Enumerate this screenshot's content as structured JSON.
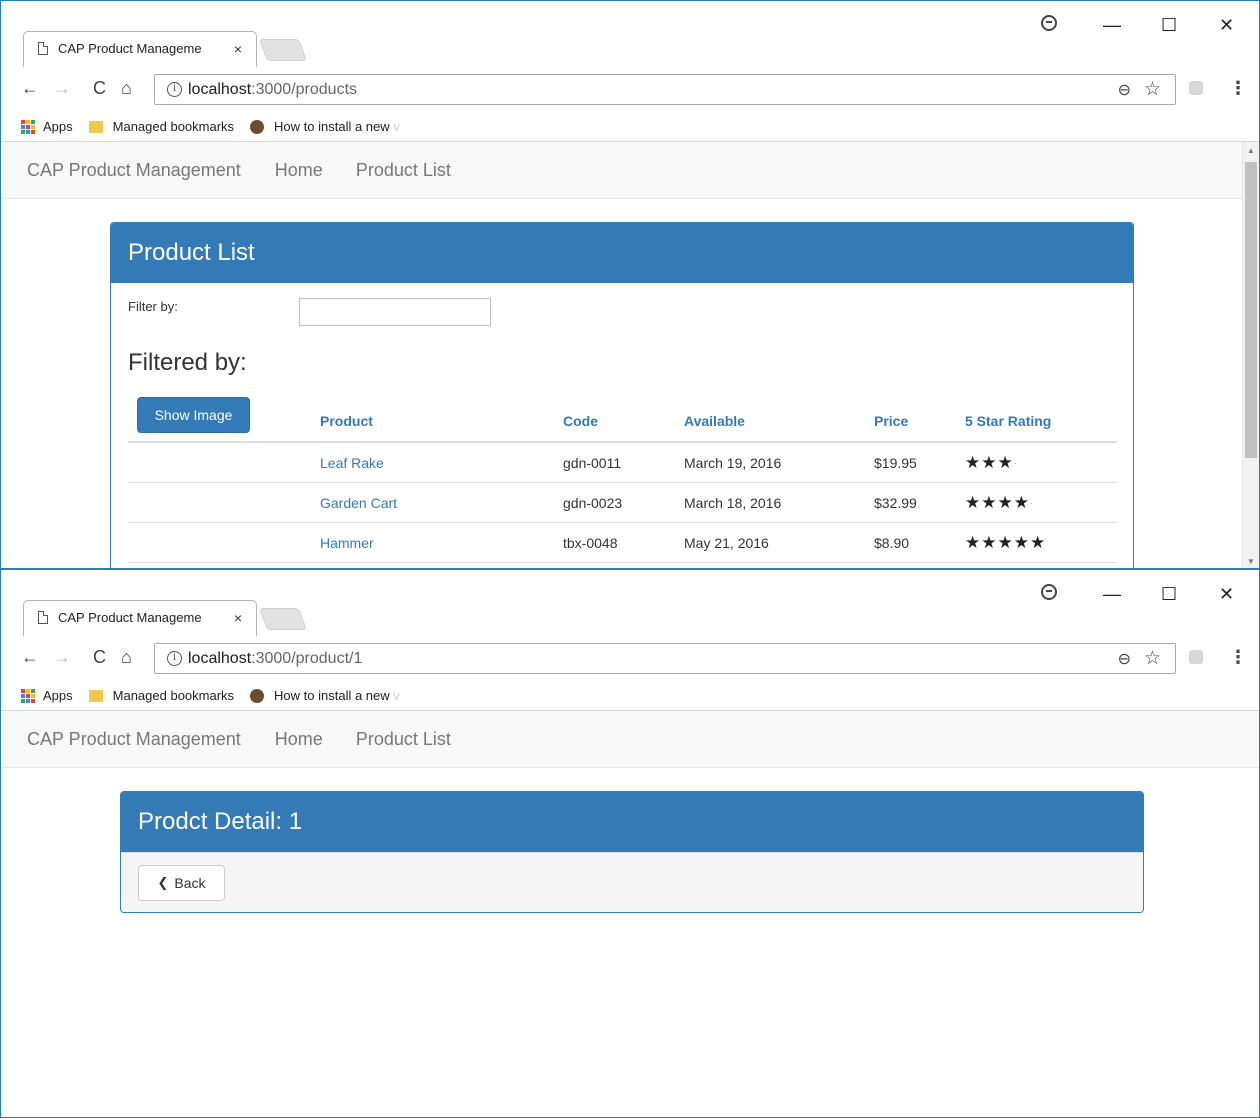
{
  "window_a": {
    "tab_title": "CAP Product Manageme",
    "tab_close": "×",
    "url_host": "localhost",
    "url_path": ":3000/products",
    "bookmarks": {
      "apps": "Apps",
      "managed": "Managed bookmarks",
      "howto": "How to install a new",
      "howto_fade": "v"
    },
    "nav": {
      "brand": "CAP Product Management",
      "home": "Home",
      "list": "Product List"
    },
    "panel": {
      "title": "Product List",
      "filter_label": "Filter by:",
      "filter_value": "",
      "filtered_by": "Filtered by:",
      "show_image": "Show Image",
      "columns": {
        "product": "Product",
        "code": "Code",
        "available": "Available",
        "price": "Price",
        "rating": "5 Star Rating"
      },
      "rows": [
        {
          "product": "Leaf Rake",
          "code": "gdn-0011",
          "available": "March 19, 2016",
          "price": "$19.95",
          "stars": "★★★",
          "partial": "·",
          "rating": 3.2
        },
        {
          "product": "Garden Cart",
          "code": "gdn-0023",
          "available": "March 18, 2016",
          "price": "$32.99",
          "stars": "★★★★",
          "partial": "·",
          "rating": 4.2
        },
        {
          "product": "Hammer",
          "code": "tbx-0048",
          "available": "May 21, 2016",
          "price": "$8.90",
          "stars": "★★★★★",
          "partial": "",
          "rating": 4.8
        }
      ]
    }
  },
  "window_b": {
    "tab_title": "CAP Product Manageme",
    "tab_close": "×",
    "url_host": "localhost",
    "url_path": ":3000/product/1",
    "bookmarks": {
      "apps": "Apps",
      "managed": "Managed bookmarks",
      "howto": "How to install a new",
      "howto_fade": "v"
    },
    "nav": {
      "brand": "CAP Product Management",
      "home": "Home",
      "list": "Product List"
    },
    "panel": {
      "title": "Prodct Detail: 1",
      "back": "Back"
    }
  },
  "chrome": {
    "back": "←",
    "forward": "→",
    "reload": "C",
    "home": "⌂",
    "minimize": "—",
    "maximize": "☐",
    "close": "✕",
    "zoom": "⊖",
    "star": "☆",
    "menu": "⋮",
    "info": "i"
  },
  "colors": {
    "primary": "#337ab7",
    "navbar_bg": "#f8f8f8",
    "window_border": "#2a7db5"
  }
}
